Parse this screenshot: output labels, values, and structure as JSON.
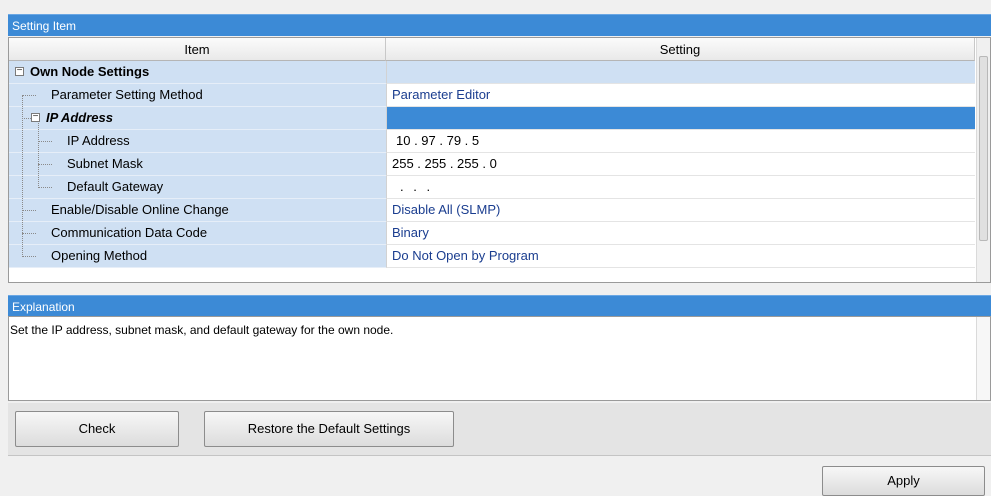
{
  "setting_panel": {
    "title": "Setting Item",
    "columns": {
      "item": "Item",
      "setting": "Setting"
    },
    "rows": [
      {
        "label": "Own Node Settings",
        "value": ""
      },
      {
        "label": "Parameter Setting Method",
        "value": "Parameter Editor"
      },
      {
        "label": "IP Address",
        "value": ""
      },
      {
        "label": "IP Address",
        "value": "10 . 97 . 79 . 5"
      },
      {
        "label": "Subnet Mask",
        "value": "255 . 255 . 255 . 0"
      },
      {
        "label": "Default Gateway",
        "value": ". . ."
      },
      {
        "label": "Enable/Disable Online Change",
        "value": "Disable All (SLMP)"
      },
      {
        "label": "Communication Data Code",
        "value": "Binary"
      },
      {
        "label": "Opening Method",
        "value": "Do Not Open by Program"
      }
    ]
  },
  "explanation": {
    "title": "Explanation",
    "text": "Set the IP address, subnet mask, and default gateway for the own node."
  },
  "buttons": {
    "check": "Check",
    "restore": "Restore the Default Settings",
    "apply": "Apply"
  },
  "icons": {
    "collapse": "minus-box-icon",
    "scroll_up": "arrow-up-icon",
    "scroll_down": "arrow-down-icon"
  },
  "colors": {
    "header_blue": "#3c8ad6",
    "item_cell_blue": "#cfe0f3",
    "setting_text_blue": "#1a3d8f"
  }
}
